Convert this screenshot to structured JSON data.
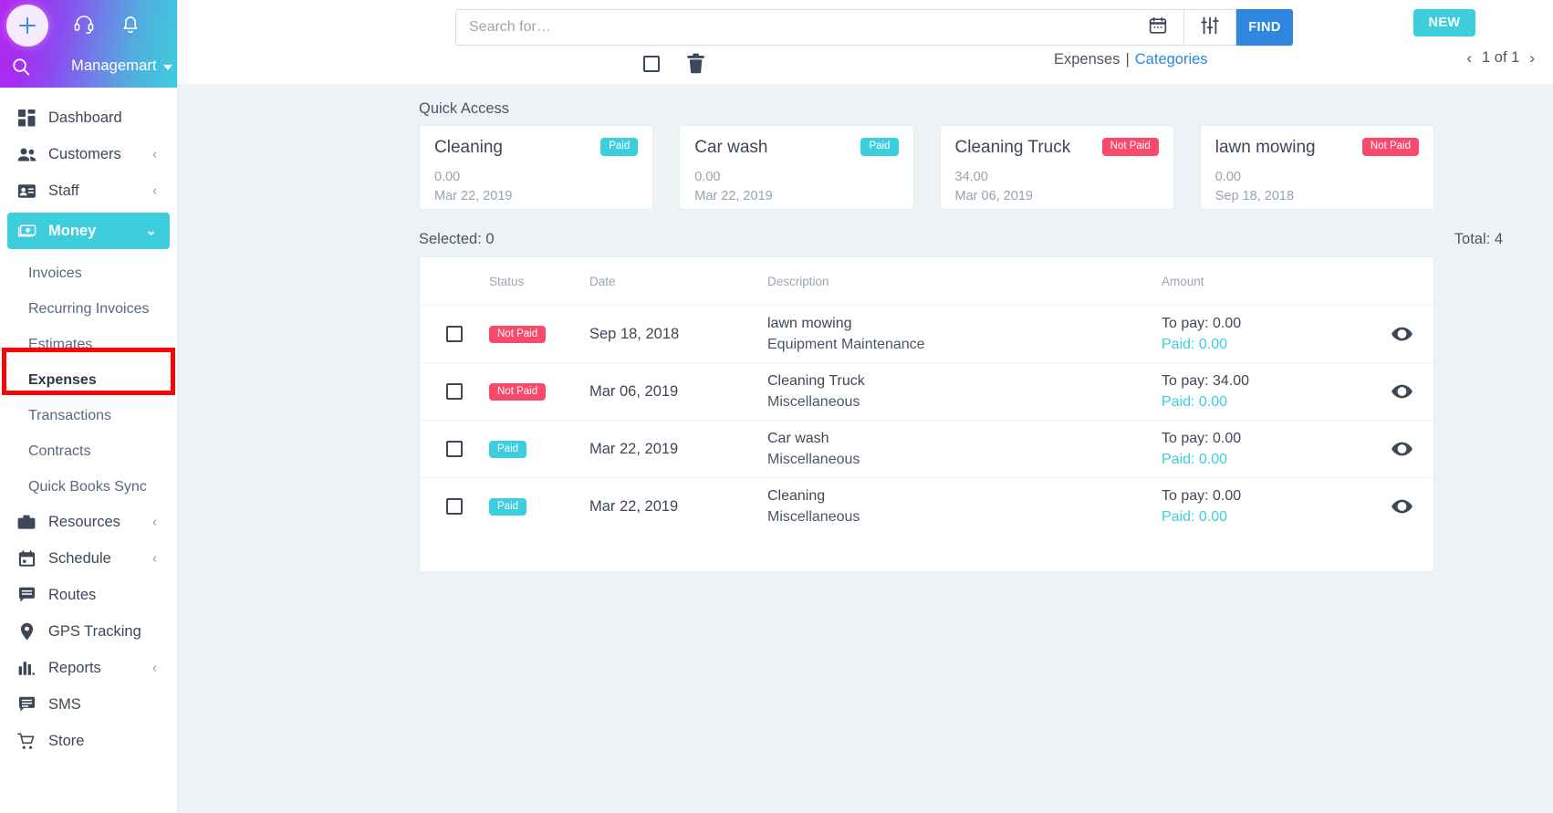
{
  "app": {
    "account_name": "Managemart",
    "brand_accent": "#3ccedd",
    "find_accent": "#2e86de",
    "notpaid_color": "#fa4a6b",
    "highlight_color": "#fa0505"
  },
  "sidebar": {
    "add_icon": "plus-icon",
    "support_icon": "headset-icon",
    "notifications_icon": "bell-icon",
    "search_icon": "search-icon",
    "nav": [
      {
        "label": "Dashboard",
        "icon": "dashboard-icon",
        "expandable": false,
        "active": false
      },
      {
        "label": "Customers",
        "icon": "customers-icon",
        "expandable": true,
        "active": false
      },
      {
        "label": "Staff",
        "icon": "staff-icon",
        "expandable": true,
        "active": false
      },
      {
        "label": "Money",
        "icon": "money-icon",
        "expandable": true,
        "active": true
      }
    ],
    "sub_items": [
      {
        "label": "Invoices",
        "selected": false
      },
      {
        "label": "Recurring Invoices",
        "selected": false
      },
      {
        "label": "Estimates",
        "selected": false
      },
      {
        "label": "Expenses",
        "selected": true
      },
      {
        "label": "Transactions",
        "selected": false
      },
      {
        "label": "Contracts",
        "selected": false
      },
      {
        "label": "Quick Books Sync",
        "selected": false
      }
    ],
    "nav_bottom": [
      {
        "label": "Resources",
        "icon": "briefcase-icon",
        "expandable": true
      },
      {
        "label": "Schedule",
        "icon": "calendar-icon",
        "expandable": true
      },
      {
        "label": "Routes",
        "icon": "routes-icon",
        "expandable": false
      },
      {
        "label": "GPS Tracking",
        "icon": "map-pin-icon",
        "expandable": false
      },
      {
        "label": "Reports",
        "icon": "bar-chart-icon",
        "expandable": true
      },
      {
        "label": "SMS",
        "icon": "message-icon",
        "expandable": false
      },
      {
        "label": "Store",
        "icon": "cart-icon",
        "expandable": false
      }
    ]
  },
  "topbar": {
    "search_placeholder": "Search for…",
    "search_value": "",
    "calendar_icon": "calendar-icon",
    "filter_icon": "sliders-icon",
    "find_label": "FIND",
    "new_label": "NEW",
    "select_all_icon": "checkbox-icon",
    "delete_icon": "trash-icon",
    "tab_expenses": "Expenses",
    "tab_separator": "|",
    "tab_categories": "Categories",
    "pager_text": "1 of 1",
    "pager_prev_icon": "chevron-left-icon",
    "pager_next_icon": "chevron-right-icon"
  },
  "quick_access": {
    "title": "Quick Access",
    "cards": [
      {
        "title": "Cleaning",
        "status": "Paid",
        "paid": true,
        "amount": "0.00",
        "date": "Mar 22, 2019"
      },
      {
        "title": "Car wash",
        "status": "Paid",
        "paid": true,
        "amount": "0.00",
        "date": "Mar 22, 2019"
      },
      {
        "title": "Cleaning Truck",
        "status": "Not Paid",
        "paid": false,
        "amount": "34.00",
        "date": "Mar 06, 2019"
      },
      {
        "title": "lawn mowing",
        "status": "Not Paid",
        "paid": false,
        "amount": "0.00",
        "date": "Sep 18, 2018"
      }
    ]
  },
  "list": {
    "selected_label": "Selected: 0",
    "total_label": "Total: 4",
    "headers": {
      "status": "Status",
      "date": "Date",
      "description": "Description",
      "amount": "Amount"
    },
    "rows": [
      {
        "status": "Not Paid",
        "paid": false,
        "date": "Sep 18, 2018",
        "description": "lawn mowing",
        "category": "Equipment Maintenance",
        "to_pay": "To pay: 0.00",
        "paid_amount": "Paid: 0.00",
        "view_icon": "eye-icon"
      },
      {
        "status": "Not Paid",
        "paid": false,
        "date": "Mar 06, 2019",
        "description": "Cleaning Truck",
        "category": "Miscellaneous",
        "to_pay": "To pay: 34.00",
        "paid_amount": "Paid: 0.00",
        "view_icon": "eye-icon"
      },
      {
        "status": "Paid",
        "paid": true,
        "date": "Mar 22, 2019",
        "description": "Car wash",
        "category": "Miscellaneous",
        "to_pay": "To pay: 0.00",
        "paid_amount": "Paid: 0.00",
        "view_icon": "eye-icon"
      },
      {
        "status": "Paid",
        "paid": true,
        "date": "Mar 22, 2019",
        "description": "Cleaning",
        "category": "Miscellaneous",
        "to_pay": "To pay: 0.00",
        "paid_amount": "Paid: 0.00",
        "view_icon": "eye-icon"
      }
    ]
  }
}
